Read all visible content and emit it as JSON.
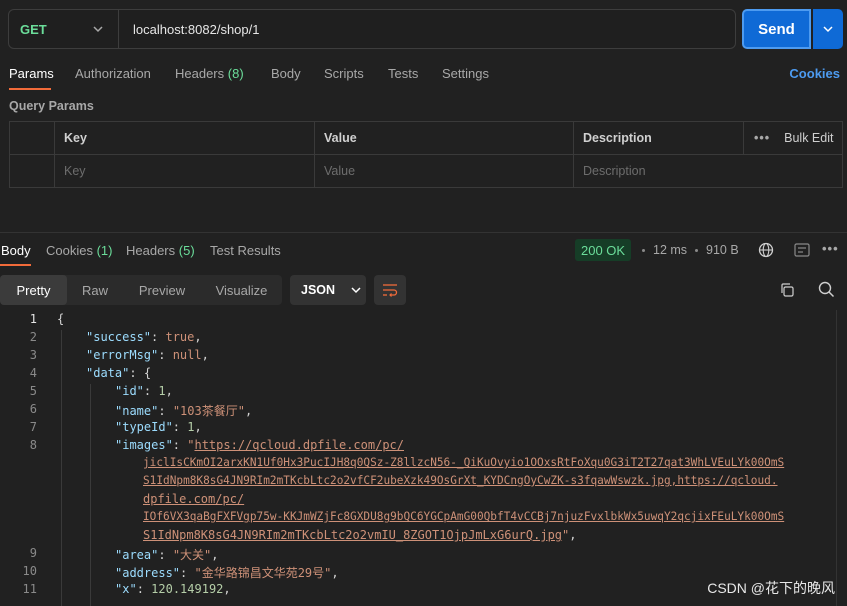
{
  "request": {
    "method": "GET",
    "url": "localhost:8082/shop/1",
    "send_label": "Send"
  },
  "request_tabs": {
    "params": "Params",
    "authorization": "Authorization",
    "headers": "Headers",
    "headers_count": "(8)",
    "body": "Body",
    "scripts": "Scripts",
    "tests": "Tests",
    "settings": "Settings",
    "cookies": "Cookies"
  },
  "query_params": {
    "title": "Query Params",
    "headers": {
      "key": "Key",
      "value": "Value",
      "description": "Description",
      "bulk_edit": "Bulk Edit"
    },
    "placeholders": {
      "key": "Key",
      "value": "Value",
      "description": "Description"
    }
  },
  "response": {
    "tabs": {
      "body": "Body",
      "cookies": "Cookies",
      "cookies_count": "(1)",
      "headers": "Headers",
      "headers_count": "(5)",
      "test_results": "Test Results"
    },
    "status": "200 OK",
    "time": "12 ms",
    "size": "910 B",
    "views": {
      "pretty": "Pretty",
      "raw": "Raw",
      "preview": "Preview",
      "visualize": "Visualize"
    },
    "format": "JSON"
  },
  "code": {
    "line_numbers": [
      "1",
      "2",
      "3",
      "4",
      "5",
      "6",
      "7",
      "8",
      "9",
      "10",
      "11"
    ],
    "open_brace": "{",
    "success_key": "\"success\"",
    "success_val": "true",
    "errormsg_key": "\"errorMsg\"",
    "errormsg_val": "null",
    "data_key": "\"data\"",
    "data_open": "{",
    "id_key": "\"id\"",
    "id_val": "1",
    "name_key": "\"name\"",
    "name_val": "\"103茶餐厅\"",
    "typeid_key": "\"typeId\"",
    "typeid_val": "1",
    "images_key": "\"images\"",
    "images_line1": "https://qcloud.dpfile.com/pc/",
    "images_line2": "jiclIsCKmOI2arxKN1Uf0Hx3PucIJH8q0QSz-Z8llzcN56-_QiKuOvyio1OOxsRtFoXqu0G3iT2T27qat3WhLVEuLYk00OmS",
    "images_line3": "S1IdNpm8K8sG4JN9RIm2mTKcbLtc2o2vfCF2ubeXzk49OsGrXt_KYDCngOyCwZK-s3fqawWswzk.jpg,https://qcloud.",
    "images_line4": "dpfile.com/pc/",
    "images_line5": "IOf6VX3qaBgFXFVgp75w-KKJmWZjFc8GXDU8g9bQC6YGCpAmG00QbfT4vCCBj7njuzFvxlbkWx5uwqY2qcjixFEuLYk00OmS",
    "images_line6": "S1IdNpm8K8sG4JN9RIm2mTKcbLtc2o2vmIU_8ZGOT1OjpJmLxG6urQ.jpg",
    "area_key": "\"area\"",
    "area_val": "\"大关\"",
    "address_key": "\"address\"",
    "address_val": "\"金华路锦昌文华苑29号\"",
    "x_key": "\"x\"",
    "x_val": "120.149192"
  },
  "watermark": "CSDN @花下的晚风",
  "colors": {
    "accent": "#f26b3a",
    "send": "#0f6ad6",
    "ok": "#6bdd9a",
    "link": "#4d9bf0"
  }
}
